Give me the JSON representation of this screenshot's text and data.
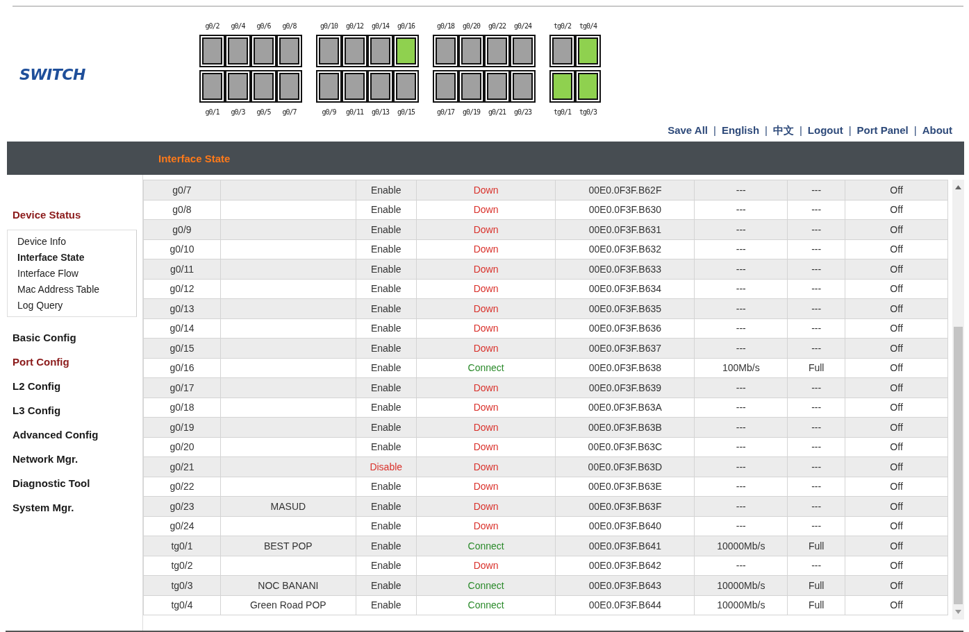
{
  "logo": "SWITCH",
  "port_panel": [
    {
      "top": [
        {
          "label": "g0/2",
          "up": false
        },
        {
          "label": "g0/4",
          "up": false
        },
        {
          "label": "g0/6",
          "up": false
        },
        {
          "label": "g0/8",
          "up": false
        }
      ],
      "bottom": [
        {
          "label": "g0/1",
          "up": false
        },
        {
          "label": "g0/3",
          "up": false
        },
        {
          "label": "g0/5",
          "up": false
        },
        {
          "label": "g0/7",
          "up": false
        }
      ]
    },
    {
      "top": [
        {
          "label": "g0/10",
          "up": false
        },
        {
          "label": "g0/12",
          "up": false
        },
        {
          "label": "g0/14",
          "up": false
        },
        {
          "label": "g0/16",
          "up": true
        }
      ],
      "bottom": [
        {
          "label": "g0/9",
          "up": false
        },
        {
          "label": "g0/11",
          "up": false
        },
        {
          "label": "g0/13",
          "up": false
        },
        {
          "label": "g0/15",
          "up": false
        }
      ]
    },
    {
      "top": [
        {
          "label": "g0/18",
          "up": false
        },
        {
          "label": "g0/20",
          "up": false
        },
        {
          "label": "g0/22",
          "up": false
        },
        {
          "label": "g0/24",
          "up": false
        }
      ],
      "bottom": [
        {
          "label": "g0/17",
          "up": false
        },
        {
          "label": "g0/19",
          "up": false
        },
        {
          "label": "g0/21",
          "up": false
        },
        {
          "label": "g0/23",
          "up": false
        }
      ]
    },
    {
      "top": [
        {
          "label": "tg0/2",
          "up": false
        },
        {
          "label": "tg0/4",
          "up": true
        }
      ],
      "bottom": [
        {
          "label": "tg0/1",
          "up": true
        },
        {
          "label": "tg0/3",
          "up": true
        }
      ]
    }
  ],
  "nav_links": {
    "separator": "|",
    "items": [
      "Save All",
      "English",
      "中文",
      "Logout",
      "Port Panel",
      "About"
    ]
  },
  "page_title": "Interface State",
  "sidebar": [
    {
      "label": "Device Status",
      "highlighted": true,
      "children": [
        {
          "label": "Device Info",
          "selected": false
        },
        {
          "label": "Interface State",
          "selected": true
        },
        {
          "label": "Interface Flow",
          "selected": false
        },
        {
          "label": "Mac Address Table",
          "selected": false
        },
        {
          "label": "Log Query",
          "selected": false
        }
      ]
    },
    {
      "label": "Basic Config",
      "highlighted": false
    },
    {
      "label": "Port Config",
      "highlighted": true
    },
    {
      "label": "L2 Config",
      "highlighted": false
    },
    {
      "label": "L3 Config",
      "highlighted": false
    },
    {
      "label": "Advanced Config",
      "highlighted": false
    },
    {
      "label": "Network Mgr.",
      "highlighted": false
    },
    {
      "label": "Diagnostic Tool",
      "highlighted": false
    },
    {
      "label": "System Mgr.",
      "highlighted": false
    }
  ],
  "table": {
    "rows": [
      {
        "port": "g0/7",
        "description": "",
        "admin": "Enable",
        "admin_enabled": true,
        "link": "Down",
        "link_up": false,
        "mac": "00E0.0F3F.B62F",
        "speed": "---",
        "duplex": "---",
        "flow": "Off"
      },
      {
        "port": "g0/8",
        "description": "",
        "admin": "Enable",
        "admin_enabled": true,
        "link": "Down",
        "link_up": false,
        "mac": "00E0.0F3F.B630",
        "speed": "---",
        "duplex": "---",
        "flow": "Off"
      },
      {
        "port": "g0/9",
        "description": "",
        "admin": "Enable",
        "admin_enabled": true,
        "link": "Down",
        "link_up": false,
        "mac": "00E0.0F3F.B631",
        "speed": "---",
        "duplex": "---",
        "flow": "Off"
      },
      {
        "port": "g0/10",
        "description": "",
        "admin": "Enable",
        "admin_enabled": true,
        "link": "Down",
        "link_up": false,
        "mac": "00E0.0F3F.B632",
        "speed": "---",
        "duplex": "---",
        "flow": "Off"
      },
      {
        "port": "g0/11",
        "description": "",
        "admin": "Enable",
        "admin_enabled": true,
        "link": "Down",
        "link_up": false,
        "mac": "00E0.0F3F.B633",
        "speed": "---",
        "duplex": "---",
        "flow": "Off"
      },
      {
        "port": "g0/12",
        "description": "",
        "admin": "Enable",
        "admin_enabled": true,
        "link": "Down",
        "link_up": false,
        "mac": "00E0.0F3F.B634",
        "speed": "---",
        "duplex": "---",
        "flow": "Off"
      },
      {
        "port": "g0/13",
        "description": "",
        "admin": "Enable",
        "admin_enabled": true,
        "link": "Down",
        "link_up": false,
        "mac": "00E0.0F3F.B635",
        "speed": "---",
        "duplex": "---",
        "flow": "Off"
      },
      {
        "port": "g0/14",
        "description": "",
        "admin": "Enable",
        "admin_enabled": true,
        "link": "Down",
        "link_up": false,
        "mac": "00E0.0F3F.B636",
        "speed": "---",
        "duplex": "---",
        "flow": "Off"
      },
      {
        "port": "g0/15",
        "description": "",
        "admin": "Enable",
        "admin_enabled": true,
        "link": "Down",
        "link_up": false,
        "mac": "00E0.0F3F.B637",
        "speed": "---",
        "duplex": "---",
        "flow": "Off"
      },
      {
        "port": "g0/16",
        "description": "",
        "admin": "Enable",
        "admin_enabled": true,
        "link": "Connect",
        "link_up": true,
        "mac": "00E0.0F3F.B638",
        "speed": "100Mb/s",
        "duplex": "Full",
        "flow": "Off"
      },
      {
        "port": "g0/17",
        "description": "",
        "admin": "Enable",
        "admin_enabled": true,
        "link": "Down",
        "link_up": false,
        "mac": "00E0.0F3F.B639",
        "speed": "---",
        "duplex": "---",
        "flow": "Off"
      },
      {
        "port": "g0/18",
        "description": "",
        "admin": "Enable",
        "admin_enabled": true,
        "link": "Down",
        "link_up": false,
        "mac": "00E0.0F3F.B63A",
        "speed": "---",
        "duplex": "---",
        "flow": "Off"
      },
      {
        "port": "g0/19",
        "description": "",
        "admin": "Enable",
        "admin_enabled": true,
        "link": "Down",
        "link_up": false,
        "mac": "00E0.0F3F.B63B",
        "speed": "---",
        "duplex": "---",
        "flow": "Off"
      },
      {
        "port": "g0/20",
        "description": "",
        "admin": "Enable",
        "admin_enabled": true,
        "link": "Down",
        "link_up": false,
        "mac": "00E0.0F3F.B63C",
        "speed": "---",
        "duplex": "---",
        "flow": "Off"
      },
      {
        "port": "g0/21",
        "description": "",
        "admin": "Disable",
        "admin_enabled": false,
        "link": "Down",
        "link_up": false,
        "mac": "00E0.0F3F.B63D",
        "speed": "---",
        "duplex": "---",
        "flow": "Off"
      },
      {
        "port": "g0/22",
        "description": "",
        "admin": "Enable",
        "admin_enabled": true,
        "link": "Down",
        "link_up": false,
        "mac": "00E0.0F3F.B63E",
        "speed": "---",
        "duplex": "---",
        "flow": "Off"
      },
      {
        "port": "g0/23",
        "description": "MASUD",
        "admin": "Enable",
        "admin_enabled": true,
        "link": "Down",
        "link_up": false,
        "mac": "00E0.0F3F.B63F",
        "speed": "---",
        "duplex": "---",
        "flow": "Off"
      },
      {
        "port": "g0/24",
        "description": "",
        "admin": "Enable",
        "admin_enabled": true,
        "link": "Down",
        "link_up": false,
        "mac": "00E0.0F3F.B640",
        "speed": "---",
        "duplex": "---",
        "flow": "Off"
      },
      {
        "port": "tg0/1",
        "description": "BEST POP",
        "admin": "Enable",
        "admin_enabled": true,
        "link": "Connect",
        "link_up": true,
        "mac": "00E0.0F3F.B641",
        "speed": "10000Mb/s",
        "duplex": "Full",
        "flow": "Off"
      },
      {
        "port": "tg0/2",
        "description": "",
        "admin": "Enable",
        "admin_enabled": true,
        "link": "Down",
        "link_up": false,
        "mac": "00E0.0F3F.B642",
        "speed": "---",
        "duplex": "---",
        "flow": "Off"
      },
      {
        "port": "tg0/3",
        "description": "NOC BANANI",
        "admin": "Enable",
        "admin_enabled": true,
        "link": "Connect",
        "link_up": true,
        "mac": "00E0.0F3F.B643",
        "speed": "10000Mb/s",
        "duplex": "Full",
        "flow": "Off"
      },
      {
        "port": "tg0/4",
        "description": "Green Road POP",
        "admin": "Enable",
        "admin_enabled": true,
        "link": "Connect",
        "link_up": true,
        "mac": "00E0.0F3F.B644",
        "speed": "10000Mb/s",
        "duplex": "Full",
        "flow": "Off"
      }
    ]
  }
}
